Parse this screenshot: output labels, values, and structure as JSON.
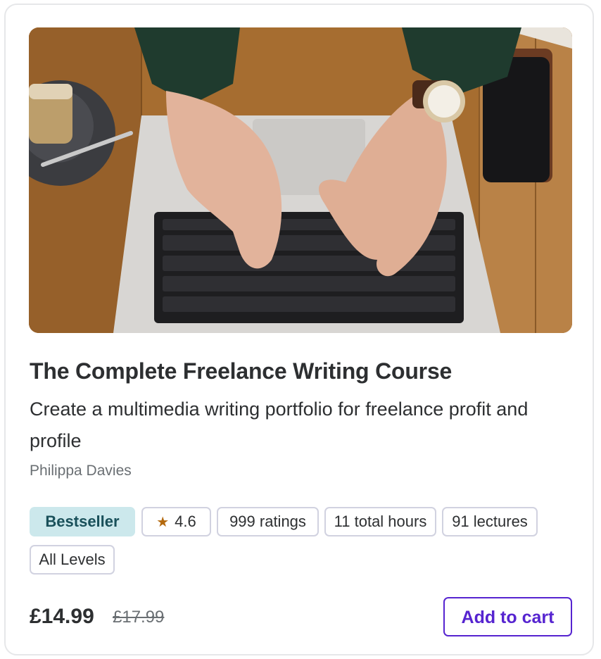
{
  "course": {
    "title": "The Complete Freelance Writing Course",
    "subtitle": "Create a multimedia writing portfolio for freelance profit and profile",
    "author": "Philippa Davies"
  },
  "badges": {
    "bestseller": "Bestseller",
    "rating": "4.6",
    "ratings_count": "999 ratings",
    "hours": "11 total hours",
    "lectures": "91 lectures",
    "level": "All Levels"
  },
  "pricing": {
    "price": "£14.99",
    "original_price": "£17.99"
  },
  "actions": {
    "add_to_cart": "Add to cart"
  },
  "icons": {
    "rating": "star-icon"
  },
  "colors": {
    "accent": "#5624d0",
    "bestseller_bg": "#cce8ec",
    "star": "#b4690e"
  }
}
